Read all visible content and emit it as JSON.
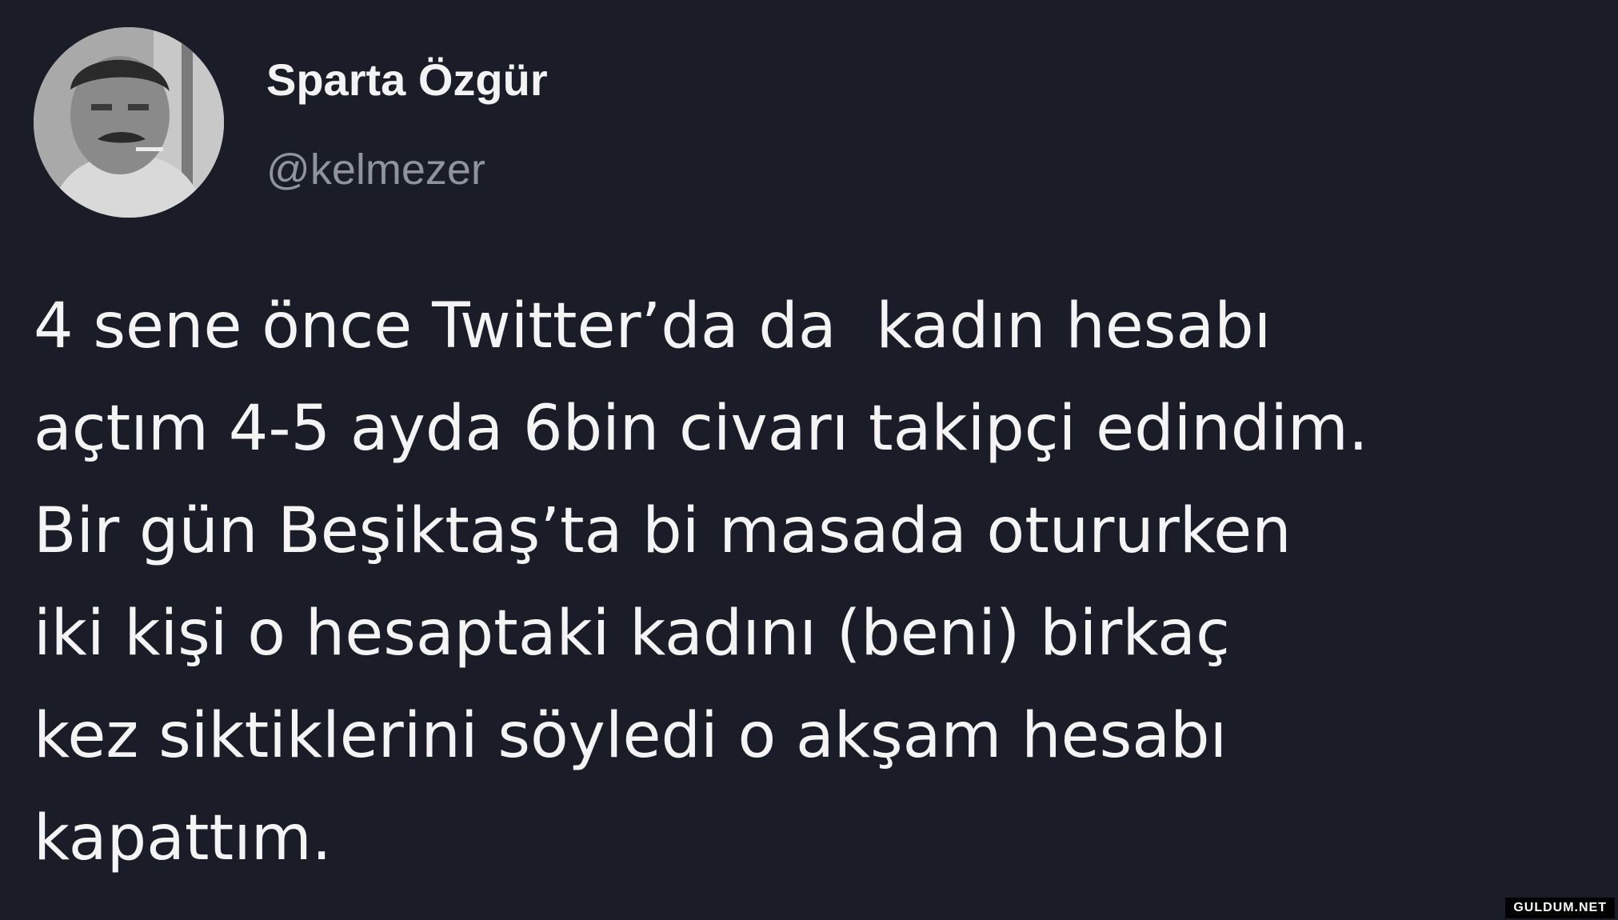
{
  "tweet": {
    "author": {
      "display_name": "Sparta Özgür",
      "handle": "@kelmezer",
      "avatar_icon": "profile-photo"
    },
    "text_lines": [
      "4 sene önce Twitter’da da  kadın hesabı",
      "açtım 4-5 ayda 6bin civarı takipçi edindim.",
      "Bir gün Beşiktaş’ta bi masada otururken",
      "iki kişi o hesaptaki kadını (beni) birkaç",
      "kez siktiklerini söyledi o akşam hesabı",
      "kapattım."
    ]
  },
  "watermark": "GULDUM.NET",
  "colors": {
    "background": "#1a1d28",
    "text": "#f4f4f4",
    "handle": "#8e949d"
  }
}
